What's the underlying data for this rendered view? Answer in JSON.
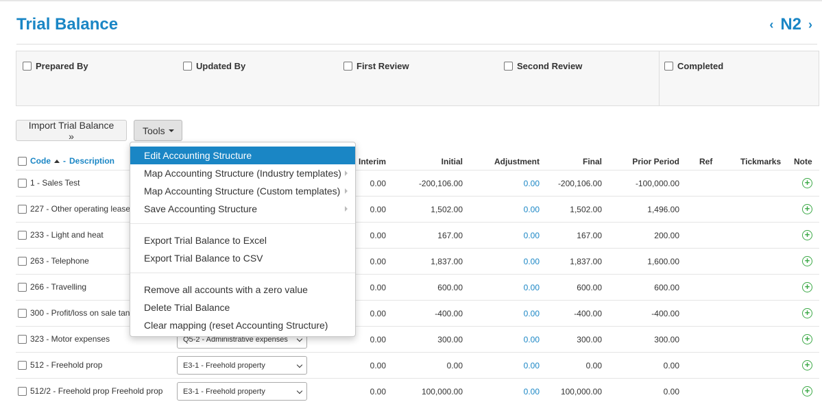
{
  "header": {
    "title": "Trial Balance",
    "code": "N2"
  },
  "review": [
    {
      "label": "Prepared By"
    },
    {
      "label": "Updated By"
    },
    {
      "label": "First Review"
    },
    {
      "label": "Second Review"
    },
    {
      "label": "Completed"
    }
  ],
  "toolbar": {
    "import_label": "Import Trial Balance »",
    "tools_label": "Tools"
  },
  "table": {
    "headers": {
      "code": "Code",
      "sep": "-",
      "description": "Description",
      "interim": "Interim",
      "initial": "Initial",
      "adjustment": "Adjustment",
      "final": "Final",
      "prior": "Prior Period",
      "ref": "Ref",
      "tickmarks": "Tickmarks",
      "note": "Note"
    },
    "rows": [
      {
        "name": "1 - Sales Test",
        "mapping": "",
        "interim": "0.00",
        "initial": "-200,106.00",
        "adjustment": "0.00",
        "final": "-200,106.00",
        "prior": "-100,000.00"
      },
      {
        "name": "227 - Other operating lease",
        "mapping": "",
        "interim": "0.00",
        "initial": "1,502.00",
        "adjustment": "0.00",
        "final": "1,502.00",
        "prior": "1,496.00"
      },
      {
        "name": "233 - Light and heat",
        "mapping": "",
        "interim": "0.00",
        "initial": "167.00",
        "adjustment": "0.00",
        "final": "167.00",
        "prior": "200.00"
      },
      {
        "name": "263 - Telephone",
        "mapping": "",
        "interim": "0.00",
        "initial": "1,837.00",
        "adjustment": "0.00",
        "final": "1,837.00",
        "prior": "1,600.00"
      },
      {
        "name": "266 - Travelling",
        "mapping": "",
        "interim": "0.00",
        "initial": "600.00",
        "adjustment": "0.00",
        "final": "600.00",
        "prior": "600.00"
      },
      {
        "name": "300 - Profit/loss on sale tan",
        "mapping": "",
        "interim": "0.00",
        "initial": "-400.00",
        "adjustment": "0.00",
        "final": "-400.00",
        "prior": "-400.00"
      },
      {
        "name": "323 - Motor expenses",
        "mapping": "Q5-2 - Administrative expenses",
        "interim": "0.00",
        "initial": "300.00",
        "adjustment": "0.00",
        "final": "300.00",
        "prior": "300.00"
      },
      {
        "name": "512 - Freehold prop",
        "mapping": "E3-1 - Freehold property",
        "interim": "0.00",
        "initial": "0.00",
        "adjustment": "0.00",
        "final": "0.00",
        "prior": "0.00"
      },
      {
        "name": "512/2 - Freehold prop Freehold prop",
        "mapping": "E3-1 - Freehold property",
        "interim": "0.00",
        "initial": "100,000.00",
        "adjustment": "0.00",
        "final": "100,000.00",
        "prior": "0.00"
      }
    ]
  },
  "menu": {
    "items": [
      {
        "label": "Edit Accounting Structure"
      },
      {
        "label": "Map Accounting Structure (Industry templates)"
      },
      {
        "label": "Map Accounting Structure (Custom templates)"
      },
      {
        "label": "Save Accounting Structure"
      },
      {
        "label": "Export Trial Balance to Excel"
      },
      {
        "label": "Export Trial Balance to CSV"
      },
      {
        "label": "Remove all accounts with a zero value"
      },
      {
        "label": "Delete Trial Balance"
      },
      {
        "label": "Clear mapping (reset Accounting Structure)"
      }
    ]
  },
  "icons": {
    "prev": "chevron-left-icon",
    "next": "chevron-right-icon",
    "note": "add-note-icon"
  },
  "colors": {
    "accent": "#1a86c5",
    "add": "#3aa845"
  }
}
